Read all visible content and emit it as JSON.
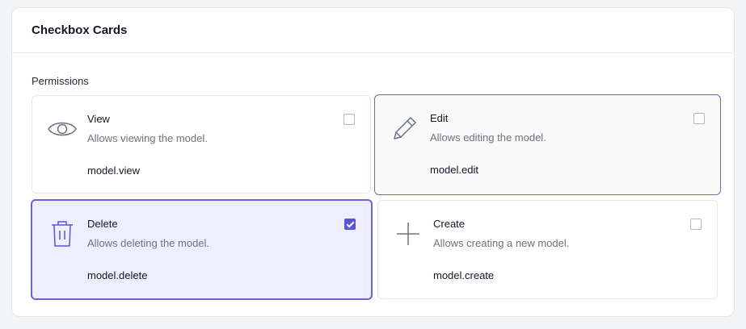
{
  "panel": {
    "title": "Checkbox Cards"
  },
  "group": {
    "label": "Permissions"
  },
  "cards": [
    {
      "title": "View",
      "description": "Allows viewing the model.",
      "code": "model.view",
      "icon": "eye-icon",
      "checked": false
    },
    {
      "title": "Edit",
      "description": "Allows editing the model.",
      "code": "model.edit",
      "icon": "pencil-icon",
      "checked": false
    },
    {
      "title": "Delete",
      "description": "Allows deleting the model.",
      "code": "model.delete",
      "icon": "trash-icon",
      "checked": true
    },
    {
      "title": "Create",
      "description": "Allows creating a new model.",
      "code": "model.create",
      "icon": "plus-icon",
      "checked": false
    }
  ],
  "colors": {
    "accent": "#5b54d6",
    "checked_background": "#efeefe",
    "border": "#e5e7eb"
  }
}
